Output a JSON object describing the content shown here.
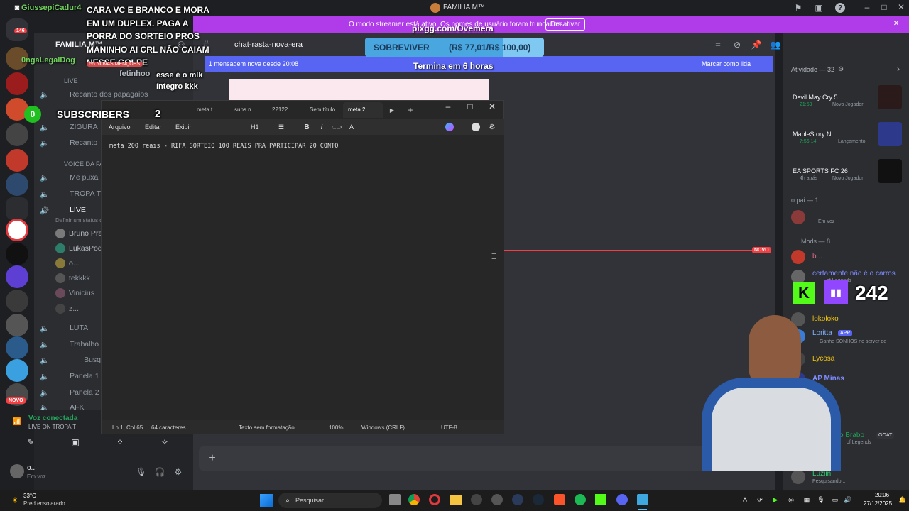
{
  "window": {
    "title": "FAMILIA M™"
  },
  "streamer_bar": {
    "text": "O modo streamer está ativo. Os nomes de usuário foram truncados.",
    "button": "Desativar",
    "url": "pixgg.com/Ovemera"
  },
  "overlay": {
    "chat_user": "GiussepiCadur4",
    "chat_message": "CARA VC E BRANCO E MORA EM UM DUPLEX. PAGA A PORRA DO SORTEIO PROS MANINHO AI CRL NÃO CAIAM NESSE GOLPE",
    "second_user": "0ngaLegalDog",
    "mentions": "55 NOVAS MENÇÕES",
    "third_user": "fetinhoo",
    "third_message": "esse é o mlk íntegro kkk",
    "sub_count_left": "0",
    "sub_label": "SUBSCRIBERS",
    "sub_count_right": "2",
    "goal_label": "SOBREVIVER",
    "goal_value": "(R$ 77,01/R$ 100,00)",
    "goal_timer": "Termina em 6 horas",
    "viewer_count": "242"
  },
  "channel_header": {
    "server_name": "FAMILIA M™",
    "channel": "chat-rasta-nova-era",
    "new_messages": "1 mensagem nova desde 20:08",
    "mark_read": "Marcar como lida",
    "search_placeholder": "Buscar FAMILIA M™"
  },
  "channels": {
    "live_header": "LIVE",
    "items": [
      "Recanto dos papagaios",
      "ZIGURA",
      "Recanto"
    ],
    "voice_header": "VOICE DA FA",
    "voice_items": [
      "Me puxa",
      "TROPA T",
      "LIVE"
    ],
    "status_hint": "Definir um status de",
    "users": [
      "Bruno Prax",
      "LukasPodo",
      "o...",
      "tekkkk",
      "Vinicius",
      "z..."
    ],
    "more_items": [
      "LUTA",
      "Trabalho",
      "Busq",
      "Panela 1",
      "Panela 2",
      "AFK"
    ]
  },
  "voice_panel": {
    "status": "Voz conectada",
    "channel": "LIVE ON TROPA T",
    "user": "o...",
    "user_status": "Em voz"
  },
  "notepad": {
    "tabs": [
      "meta t",
      "subs n",
      "22122",
      "Sem título",
      "meta 2"
    ],
    "menu": [
      "Arquivo",
      "Editar",
      "Exibir"
    ],
    "heading_select": "H1",
    "content": "meta 200 reais - RIFA SORTEIO 100 REAIS PRA PARTICIPAR 20 CONTO",
    "status": {
      "position": "Ln 1, Col 65",
      "chars": "64 caracteres",
      "format": "Texto sem formatação",
      "zoom": "100%",
      "eol": "Windows (CRLF)",
      "encoding": "UTF-8"
    }
  },
  "main": {
    "new_label": "NOVO"
  },
  "activity": {
    "header": "Atividade — 32",
    "games": [
      {
        "title": "Devil May Cry 5",
        "time": "21:59",
        "sub": "Novo Jogador"
      },
      {
        "title": "MapleStory N",
        "time": "7:56:14",
        "sub": "Lançamento"
      },
      {
        "title": "EA SPORTS FC 26",
        "time": "4h atrás",
        "sub": "Novo Jogador"
      }
    ],
    "group1": "o pai — 1",
    "group1_user_status": "Em voz",
    "group2": "Mods — 8",
    "members": [
      "b...",
      "certamente não é o carros",
      "lokoloko",
      "Loritta",
      "Lycosa",
      "AP Minas",
      "o Brabo",
      "G",
      "Luziin"
    ],
    "loritta_tag": "APP",
    "loritta_status": "Ganhe SONHOS no server de",
    "legends": "of Legends",
    "goat_tag": "GOAT",
    "luziin_status": "Pesquisando..."
  },
  "taskbar": {
    "weather_temp": "33°C",
    "weather_desc": "Pred ensolarado",
    "search": "Pesquisar",
    "time": "20:06",
    "date": "27/12/2025"
  }
}
